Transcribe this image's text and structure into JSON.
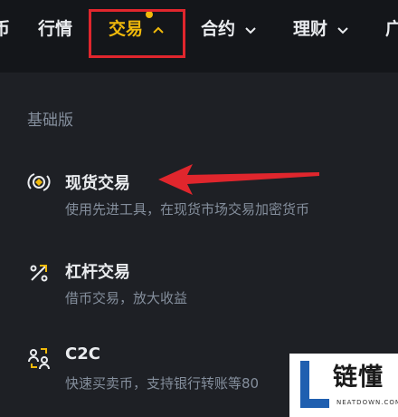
{
  "nav": {
    "items": [
      {
        "label": "币"
      },
      {
        "label": "行情"
      },
      {
        "label": "交易"
      },
      {
        "label": "合约"
      },
      {
        "label": "理财"
      },
      {
        "label": "广"
      }
    ]
  },
  "menu": {
    "section_label": "基础版",
    "items": [
      {
        "title": "现货交易",
        "desc": "使用先进工具，在现货市场交易加密货币",
        "icon": "spot-trading-icon"
      },
      {
        "title": "杠杆交易",
        "desc": "借币交易，放大收益",
        "icon": "margin-trading-icon"
      },
      {
        "title": "C2C",
        "desc": "快速买卖币，支持银行转账等80",
        "icon": "c2c-icon"
      }
    ]
  },
  "watermark": {
    "text": "链懂",
    "sub": "NEATDOWN.COM"
  },
  "colors": {
    "accent": "#f0b90b",
    "annotation_red": "#e0262d",
    "background": "#1e2025",
    "nav_bg": "#14161a"
  }
}
